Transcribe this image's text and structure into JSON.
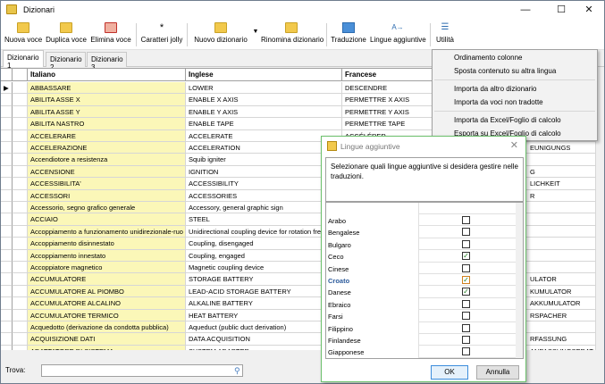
{
  "window": {
    "title": "Dizionari"
  },
  "toolbar": {
    "items": [
      "Nuova voce",
      "Duplica voce",
      "Elimina voce",
      "Caratteri jolly",
      "Nuovo dizionario",
      "Rinomina dizionario",
      "Traduzione",
      "Lingue aggiuntive",
      "Utilità"
    ]
  },
  "tabs": [
    "Dizionario 1",
    "Dizionario 2",
    "Dizionario 3"
  ],
  "grid": {
    "columns": [
      "Italiano",
      "Inglese",
      "Francese"
    ],
    "rows": [
      [
        "ABBASSARE",
        "LOWER",
        "DESCENDRE",
        ""
      ],
      [
        "ABILITA ASSE X",
        "ENABLE X AXIS",
        "PERMETTRE X AXIS",
        ""
      ],
      [
        "ABILITA ASSE Y",
        "ENABLE Y AXIS",
        "PERMETTRE Y AXIS",
        ""
      ],
      [
        "ABILITA NASTRO",
        "ENABLE TAPE",
        "PERMETTRE TAPE",
        ""
      ],
      [
        "ACCELERARE",
        "ACCELERATE",
        "ACCÉLÉRER",
        ""
      ],
      [
        "ACCELERAZIONE",
        "ACCELERATION",
        "ACCÉLÉRATION",
        "EUNIGUNGS"
      ],
      [
        "Accendiotore a resistenza",
        "Squib igniter",
        "",
        ""
      ],
      [
        "ACCENSIONE",
        "IGNITION",
        "",
        "G"
      ],
      [
        "ACCESSIBILITA'",
        "ACCESSIBILITY",
        "",
        "LICHKEIT"
      ],
      [
        "ACCESSORI",
        "ACCESSORIES",
        "",
        "R"
      ],
      [
        "Accessorio, segno grafico generale",
        "Accessory, general graphic sign",
        "",
        ""
      ],
      [
        "ACCIAIO",
        "STEEL",
        "",
        ""
      ],
      [
        "Accoppiamento a funzionamento unidirezionale-ruo",
        "Unidirectional coupling device for rotation free",
        "",
        ""
      ],
      [
        "Accoppiamento disinnestato",
        "Coupling, disengaged",
        "",
        ""
      ],
      [
        "Accoppiamento innestato",
        "Coupling, engaged",
        "",
        ""
      ],
      [
        "Accoppiatore magnetico",
        "Magnetic coupling device",
        "",
        ""
      ],
      [
        "ACCUMULATORE",
        "STORAGE BATTERY",
        "",
        "ULATOR"
      ],
      [
        "ACCUMULATORE AL PIOMBO",
        "LEAD-ACID STORAGE BATTERY",
        "",
        "KUMULATOR"
      ],
      [
        "ACCUMULATORE ALCALINO",
        "ALKALINE BATTERY",
        "",
        "AKKUMULATOR"
      ],
      [
        "ACCUMULATORE TERMICO",
        "HEAT BATTERY",
        "",
        "RSPACHER"
      ],
      [
        "Acquedotto (derivazione da condotta pubblica)",
        "Aqueduct (public duct derivation)",
        "",
        ""
      ],
      [
        "ACQUISIZIONE DATI",
        "DATA ACQUISITION",
        "",
        "RFASSUNG"
      ],
      [
        "ADATTATORE DI SISTEMA",
        "SYSTEM ADAPTER",
        "",
        "ANPASSUNGSERAT"
      ]
    ]
  },
  "search": {
    "label": "Trova:",
    "value": ""
  },
  "menu": {
    "items": [
      "Ordinamento colonne",
      "Sposta contenuto su altra lingua",
      "Importa da altro dizionario",
      "Importa da voci non tradotte",
      "Importa da Excel/Foglio di calcolo",
      "Esporta su Excel/Foglio di calcolo"
    ]
  },
  "dialog": {
    "title": "Lingue aggiuntive",
    "description": "Selezionare quali lingue aggiuntive si desidera gestire nelle traduzioni.",
    "languages": [
      {
        "name": "Arabo",
        "checked": false
      },
      {
        "name": "Bengalese",
        "checked": false
      },
      {
        "name": "Bulgaro",
        "checked": false
      },
      {
        "name": "Ceco",
        "checked": true
      },
      {
        "name": "Cinese",
        "checked": false
      },
      {
        "name": "Croato",
        "checked": true
      },
      {
        "name": "Danese",
        "checked": true
      },
      {
        "name": "Ebraico",
        "checked": false
      },
      {
        "name": "Farsi",
        "checked": false
      },
      {
        "name": "Filippino",
        "checked": false
      },
      {
        "name": "Finlandese",
        "checked": false
      },
      {
        "name": "Giapponese",
        "checked": false
      }
    ],
    "ok_label": "OK",
    "cancel_label": "Annulla"
  }
}
